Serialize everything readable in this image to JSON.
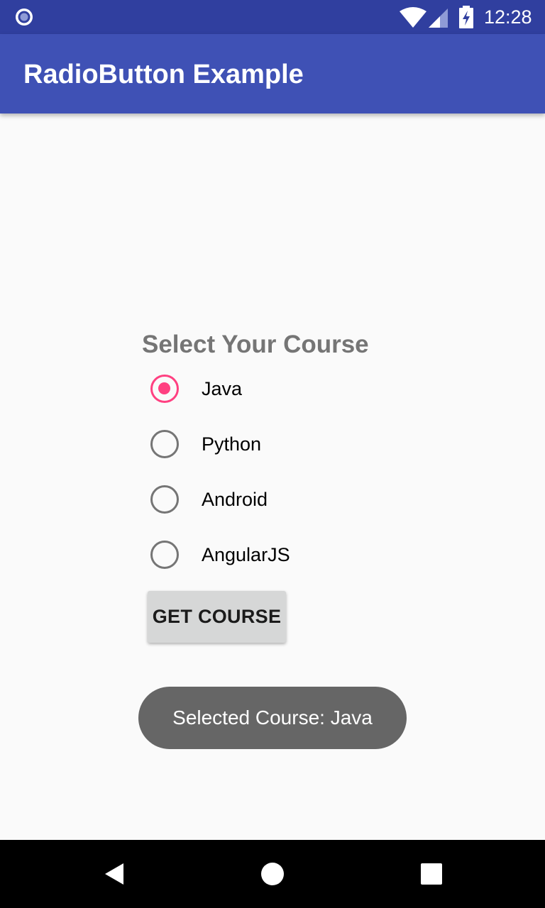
{
  "status_bar": {
    "time": "12:28",
    "color": "#303f9f",
    "icons": [
      "notification-dot-icon",
      "wifi-icon",
      "cell-signal-icon",
      "battery-charging-icon"
    ]
  },
  "app_bar": {
    "title": "RadioButton Example",
    "color": "#3f51b5"
  },
  "radio_group": {
    "title": "Select Your Course",
    "accent_color": "#ff4081",
    "selected": "Java",
    "options": [
      {
        "label": "Java",
        "checked": true
      },
      {
        "label": "Python",
        "checked": false
      },
      {
        "label": "Android",
        "checked": false
      },
      {
        "label": "AngularJS",
        "checked": false
      }
    ]
  },
  "button": {
    "label": "GET COURSE"
  },
  "toast": {
    "text": "Selected Course: Java"
  },
  "nav_bar": {
    "icons": [
      "back-icon",
      "home-icon",
      "recents-icon"
    ]
  }
}
